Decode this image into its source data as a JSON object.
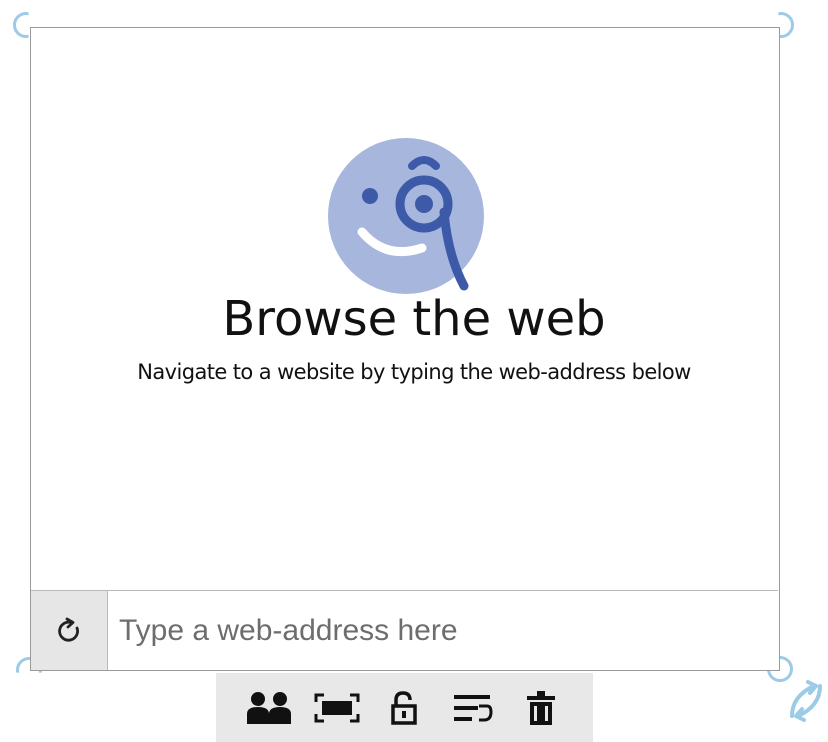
{
  "content": {
    "title": "Browse the web",
    "subtitle": "Navigate to a website by typing the web-address below"
  },
  "address_bar": {
    "placeholder": "Type a web-address here",
    "refresh_icon": "refresh-icon"
  },
  "toolbar": {
    "items": [
      {
        "icon": "users-icon"
      },
      {
        "icon": "fullscreen-icon"
      },
      {
        "icon": "unlock-icon"
      },
      {
        "icon": "text-wrap-icon"
      },
      {
        "icon": "delete-icon"
      }
    ]
  },
  "colors": {
    "logo_circle": "#a7b6dc",
    "logo_ink": "#3d5aa8",
    "handle": "#9ccbe8",
    "toolbar_bg": "#e8e8e8"
  }
}
